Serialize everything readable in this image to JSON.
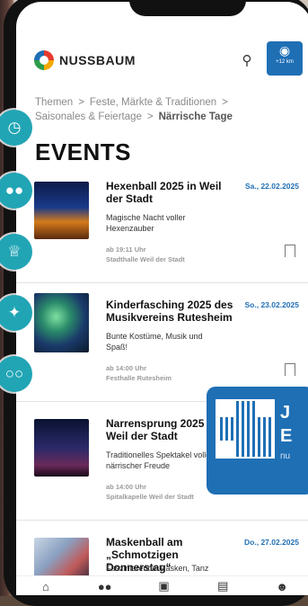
{
  "header": {
    "logo_text": "NUSSBAUM",
    "location_km": "+12 km"
  },
  "breadcrumb": {
    "items": [
      "Themen",
      "Feste, Märkte & Traditionen",
      "Saisonales & Feiertage",
      "Närrische Tage"
    ]
  },
  "page_title": "EVENTS",
  "events": [
    {
      "title": "Hexenball 2025 in Weil der Stadt",
      "date": "Sa., 22.02.2025",
      "description": "Magische Nacht voller Hexenzauber",
      "time": "ab 19:11 Uhr",
      "location": "Stadthalle Weil der Stadt"
    },
    {
      "title": "Kinderfasching 2025 des Musikvereins Rutesheim",
      "date": "So., 23.02.2025",
      "description": "Bunte Kostüme, Musik und Spaß!",
      "time": "ab 14:00 Uhr",
      "location": "Festhalle Rutesheim"
    },
    {
      "title": "Narrensprung 2025 in Weil der Stadt",
      "date": "",
      "description": "Traditionelles Spektakel voller närrischer Freude",
      "time": "ab 14:00 Uhr",
      "location": "Spitalkapelle Weil der Stadt"
    },
    {
      "title": "Maskenball am „Schmotzigen Donnerstag“",
      "date": "Do., 27.02.2025",
      "description": "Faszinierende Masken, Tanz",
      "time": "",
      "location": ""
    }
  ],
  "qr_badge": {
    "line1": "J",
    "line2": "E",
    "small": "nu"
  },
  "side_icons": [
    "calendar-clock-icon",
    "people-icon",
    "crown-icon",
    "confetti-icon",
    "balloons-icon"
  ],
  "bottom_nav": [
    "home-icon",
    "binoculars-icon",
    "shop-icon",
    "book-icon",
    "profile-icon"
  ],
  "colors": {
    "accent": "#1f6fb5",
    "bubble": "#21a5b5"
  }
}
